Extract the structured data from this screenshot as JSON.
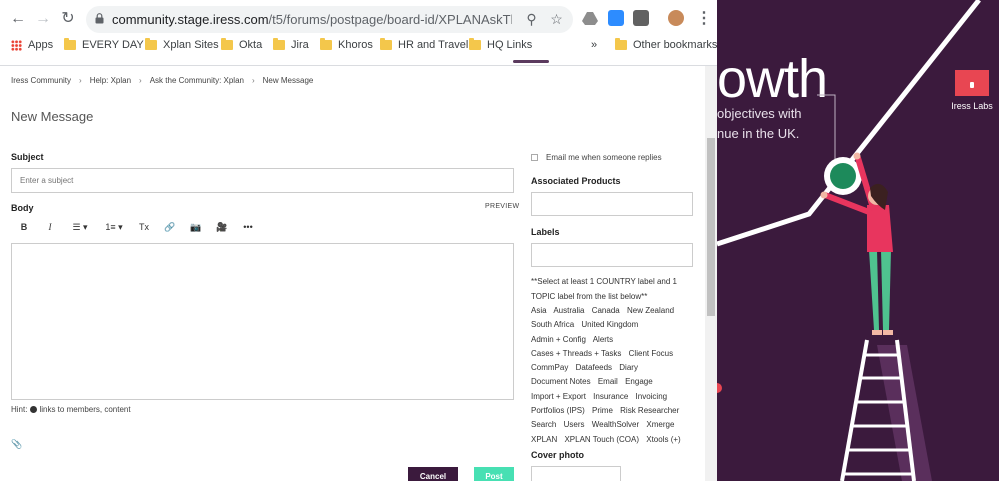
{
  "browser": {
    "url_host": "community.stage.iress.com",
    "url_path": "/t5/forums/postpage/board-id/XPLANAskTheCommu...",
    "bookmarks": [
      "Apps",
      "EVERY DAY",
      "Xplan Sites",
      "Okta",
      "Jira",
      "Khoros",
      "HR and Travel",
      "HQ Links"
    ],
    "more_bookmarks": "»",
    "other_bookmarks": "Other bookmarks"
  },
  "breadcrumb": [
    "Iress Community",
    "Help: Xplan",
    "Ask the Community: Xplan",
    "New Message"
  ],
  "page_title": "New Message",
  "form": {
    "subject_label": "Subject",
    "subject_placeholder": "Enter a subject",
    "body_label": "Body",
    "preview_label": "PREVIEW",
    "toolbar": [
      "B",
      "I",
      "☰ ▾",
      "1≡ ▾",
      "Tx",
      "🔗",
      "📷",
      "🎥",
      "•••"
    ],
    "hint_prefix": "Hint:",
    "hint_text": "links to members, content",
    "cancel_label": "Cancel",
    "post_label": "Post"
  },
  "sidebar": {
    "email_label": "Email me when someone replies",
    "products_label": "Associated Products",
    "labels_label": "Labels",
    "labels_note": "**Select at least 1 COUNTRY label and 1 TOPIC label from the list below**",
    "labels": [
      "Asia",
      "Australia",
      "Canada",
      "New Zealand",
      "South Africa",
      "United Kingdom",
      "Admin + Config",
      "Alerts",
      "Cases + Threads + Tasks",
      "Client Focus",
      "CommPay",
      "Datafeeds",
      "Diary",
      "Document Notes",
      "Email",
      "Engage",
      "Import + Export",
      "Insurance",
      "Invoicing",
      "Portfolios (IPS)",
      "Prime",
      "Risk Researcher",
      "Search",
      "Users",
      "WealthSolver",
      "Xmerge",
      "XPLAN",
      "XPLAN Touch (COA)",
      "Xtools (+)"
    ],
    "cover_photo_label": "Cover photo"
  },
  "hero": {
    "title": "owth",
    "subtitle_line1": "objectives with",
    "subtitle_line2": "nue in the UK.",
    "labs_label": "Iress Labs"
  },
  "colors": {
    "brand_purple": "#3b1a3d",
    "post_green": "#47e0b3",
    "labs_red": "#e84652"
  }
}
